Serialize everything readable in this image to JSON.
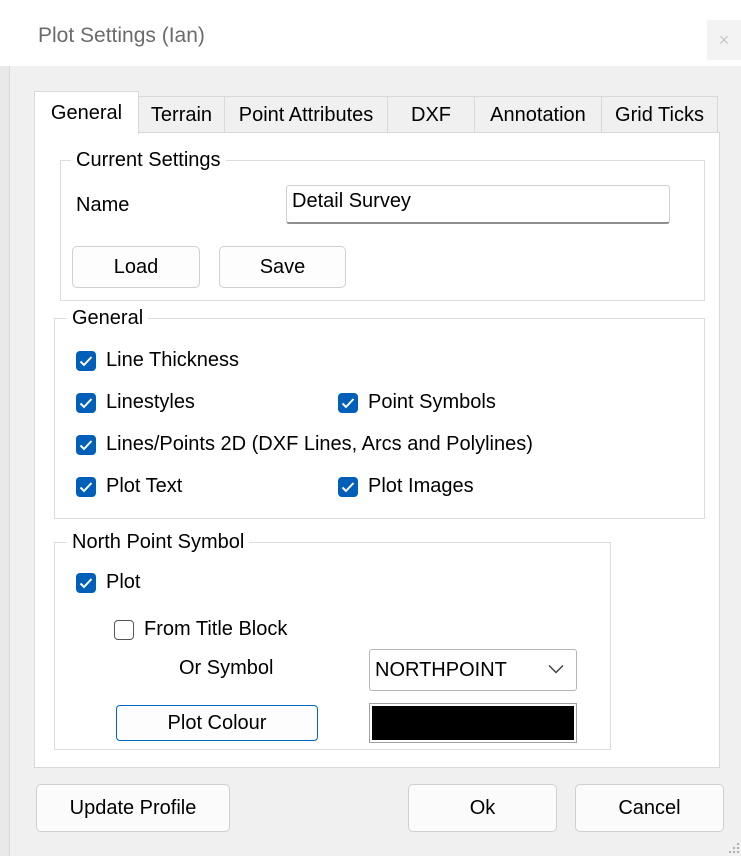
{
  "window": {
    "title": "Plot Settings  (Ian)",
    "close_glyph": "×"
  },
  "tabs": [
    {
      "label": "General",
      "active": true
    },
    {
      "label": "Terrain"
    },
    {
      "label": "Point Attributes"
    },
    {
      "label": "DXF"
    },
    {
      "label": "Annotation"
    },
    {
      "label": "Grid Ticks"
    }
  ],
  "current_settings": {
    "title": "Current Settings",
    "name_label": "Name",
    "name_value": "Detail Survey",
    "load_label": "Load",
    "save_label": "Save"
  },
  "general": {
    "title": "General",
    "line_thickness": {
      "label": "Line Thickness",
      "checked": true
    },
    "linestyles": {
      "label": "Linestyles",
      "checked": true
    },
    "point_symbols": {
      "label": "Point Symbols",
      "checked": true
    },
    "lines_points_2d": {
      "label": "Lines/Points 2D (DXF Lines, Arcs and Polylines)",
      "checked": true
    },
    "plot_text": {
      "label": "Plot Text",
      "checked": true
    },
    "plot_images": {
      "label": "Plot Images",
      "checked": true
    }
  },
  "north_point": {
    "title": "North Point Symbol",
    "plot": {
      "label": "Plot",
      "checked": true
    },
    "from_title_block": {
      "label": "From Title Block",
      "checked": false
    },
    "or_symbol_label": "Or Symbol",
    "symbol_value": "NORTHPOINT",
    "plot_colour_label": "Plot Colour",
    "colour": "#000000"
  },
  "footer": {
    "update_profile_label": "Update Profile",
    "ok_label": "Ok",
    "cancel_label": "Cancel"
  },
  "colors": {
    "accent": "#005fb8",
    "panel": "#ffffff",
    "background": "#f0f0f0"
  }
}
